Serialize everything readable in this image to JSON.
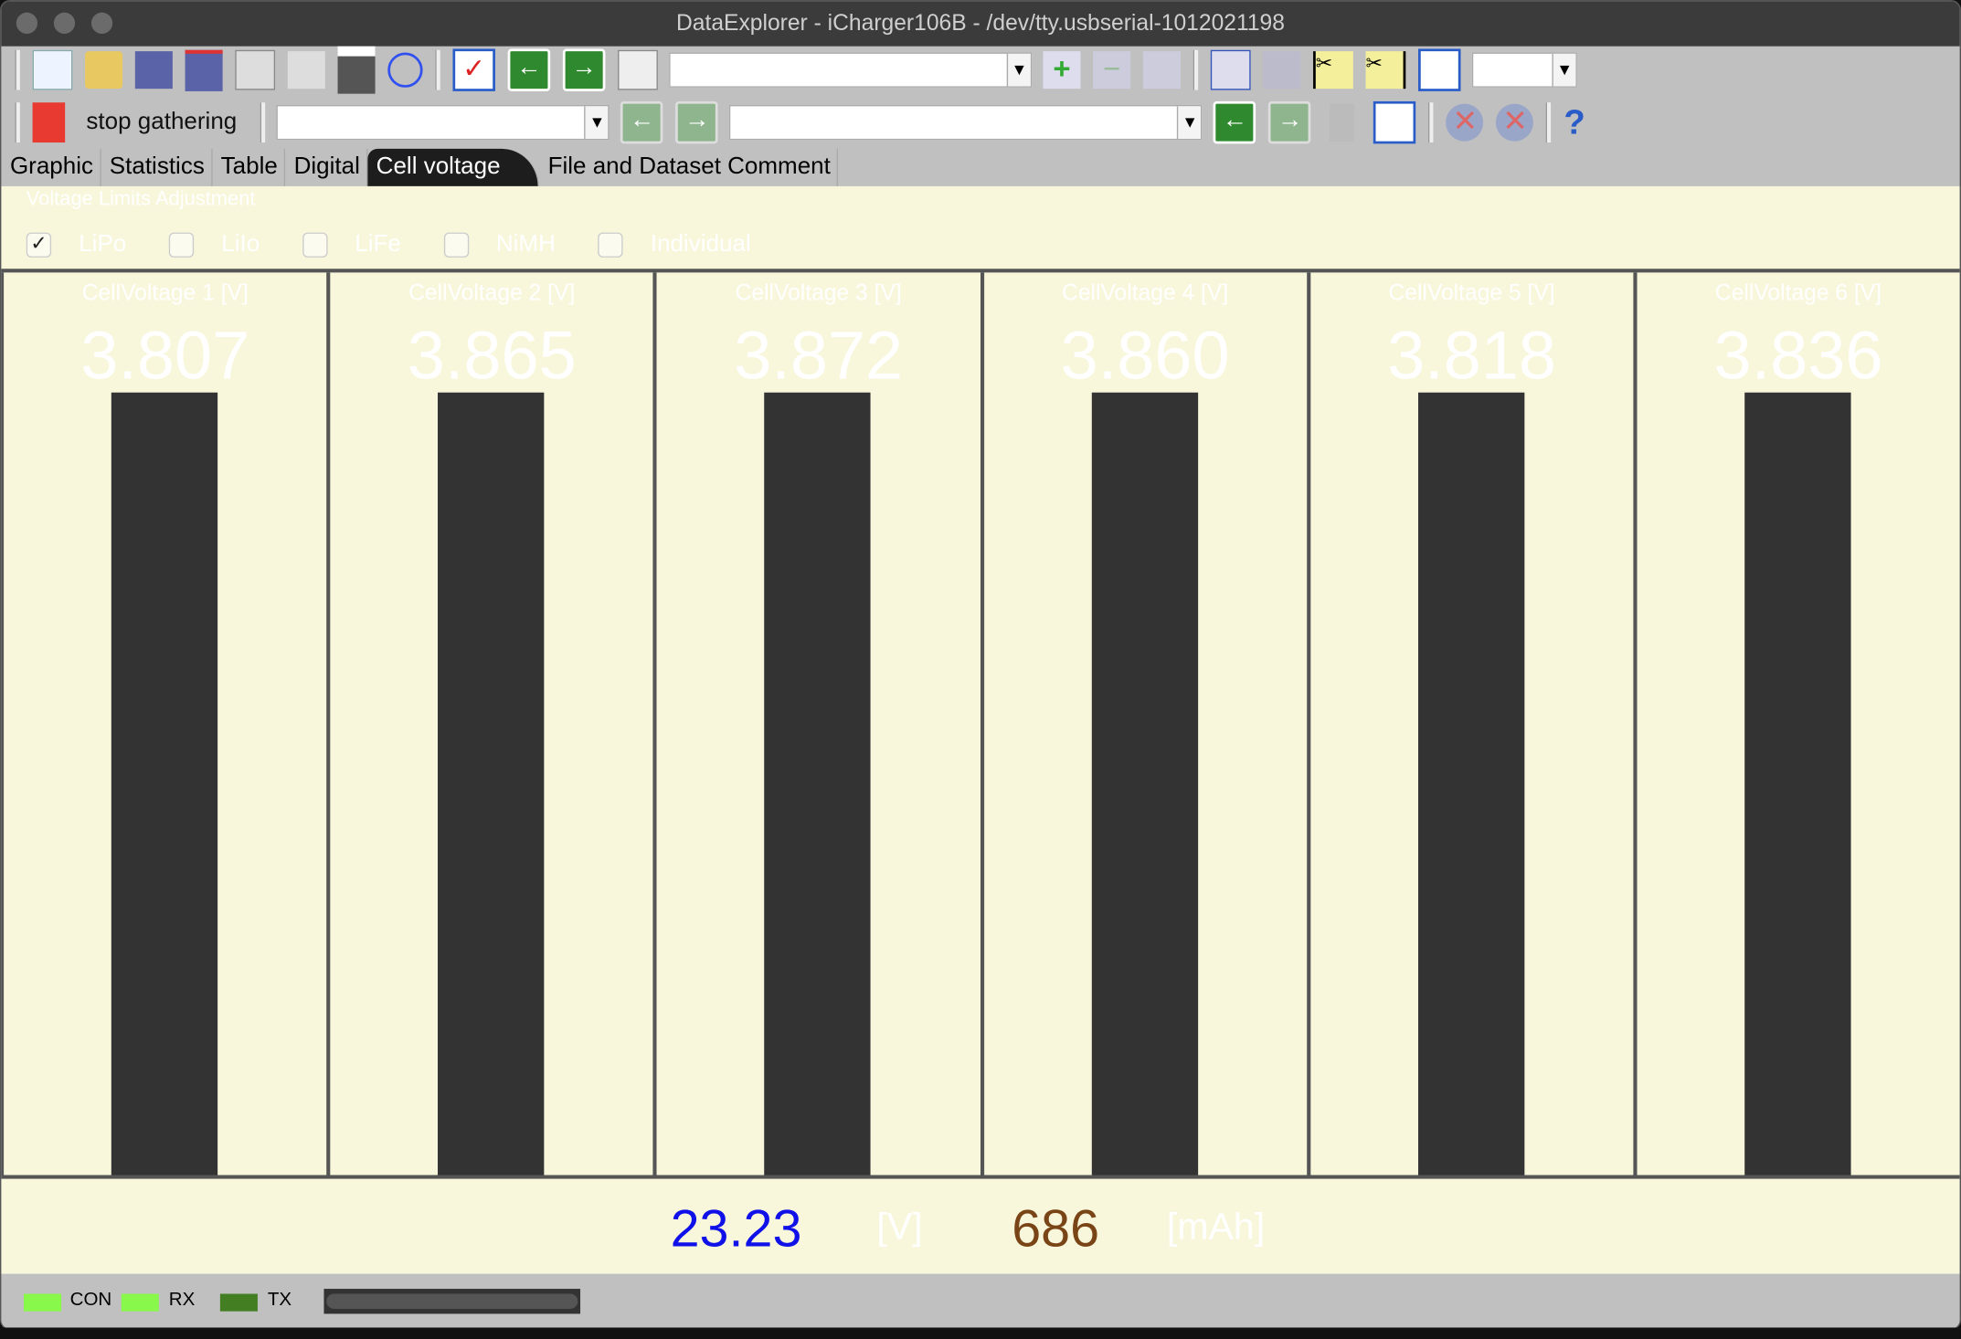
{
  "window": {
    "title": "DataExplorer  -  iCharger106B  -  /dev/tty.usbserial-1012021198"
  },
  "toolbar": {
    "row1_icons": [
      "new-file-icon",
      "open-folder-icon",
      "save-icon",
      "save-as-icon",
      "settings-sheet-icon",
      "copy-icon",
      "print-icon",
      "clock-icon"
    ],
    "row1b_icons": [
      "checklist-icon",
      "arrow-left-icon",
      "arrow-right-icon",
      "tools-icon"
    ],
    "row1c_icons": [
      "add-record-icon",
      "remove-record-icon",
      "edit-icon"
    ],
    "row1d_icons": [
      "zoom-icon",
      "pan-hand-icon",
      "cut-left-icon",
      "cut-right-icon",
      "fit-icon"
    ],
    "stop_label": "stop gathering",
    "row2_icons": [
      "trash-icon",
      "edit-note-icon",
      "disabled-globe-icon",
      "disabled-globe2-icon",
      "help-cursor-icon"
    ]
  },
  "tabs": [
    {
      "label": "Graphic"
    },
    {
      "label": "Statistics"
    },
    {
      "label": "Table"
    },
    {
      "label": "Digital"
    },
    {
      "label": "Cell voltage",
      "active": true
    },
    {
      "label": "File and Dataset Comment"
    }
  ],
  "limits": {
    "title": "Voltage Limits Adjustment",
    "options": [
      {
        "label": "LiPo",
        "checked": true
      },
      {
        "label": "LiIo",
        "checked": false
      },
      {
        "label": "LiFe",
        "checked": false
      },
      {
        "label": "NiMH",
        "checked": false
      },
      {
        "label": "Individual",
        "checked": false
      }
    ]
  },
  "cells": [
    {
      "title": "CellVoltage 1 [V]",
      "value": "3.807"
    },
    {
      "title": "CellVoltage 2 [V]",
      "value": "3.865"
    },
    {
      "title": "CellVoltage 3 [V]",
      "value": "3.872"
    },
    {
      "title": "CellVoltage 4 [V]",
      "value": "3.860"
    },
    {
      "title": "CellVoltage 5 [V]",
      "value": "3.818"
    },
    {
      "title": "CellVoltage 6 [V]",
      "value": "3.836"
    }
  ],
  "totals": {
    "voltage": "23.23",
    "voltage_unit": "[V]",
    "capacity": "686",
    "capacity_unit": "[mAh]",
    "voltage_color": "#1010e8",
    "capacity_color": "#7a4516"
  },
  "status": {
    "con": "CON",
    "rx": "RX",
    "tx": "TX",
    "con_color": "#88f84a",
    "rx_color": "#88f84a",
    "tx_color": "#437f22"
  }
}
